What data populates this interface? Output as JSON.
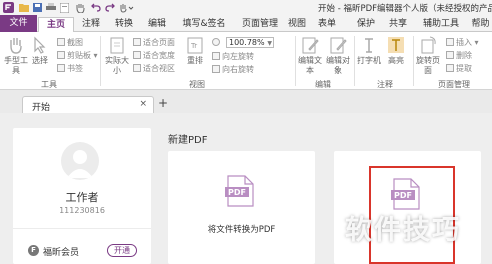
{
  "window": {
    "title": "开始 - 福昕PDF编辑器个人版（未经授权的产品"
  },
  "ribbon_tabs": [
    "文件",
    "主页",
    "注释",
    "转换",
    "编辑",
    "填写&签名",
    "页面管理",
    "视图",
    "表单",
    "保护",
    "共享",
    "辅助工具",
    "帮助"
  ],
  "ribbon": {
    "hand_tool": "手型工具",
    "select": "选择",
    "tools_group": "工具",
    "screenshot": "截图",
    "clipboard": "剪贴板",
    "bookmark": "书签",
    "actual_size": "实际大小",
    "fit_page": "适合页面",
    "fit_width": "适合宽度",
    "fit_visible": "适合视区",
    "reflow": "重排",
    "zoom_value": "100.78%",
    "rotate_left": "向左旋转",
    "rotate_right": "向右旋转",
    "view_group": "视图",
    "edit_text": "编辑文本",
    "edit_object": "编辑对象",
    "edit_group": "编辑",
    "typewriter": "打字机",
    "highlight": "高亮",
    "comment_group": "注释",
    "rotate_page": "旋转页面",
    "insert": "插入",
    "delete": "删除",
    "extract": "提取",
    "page_mgmt_group": "页面管理"
  },
  "doc_tabs": {
    "active": "开始",
    "close": "×",
    "add": "+"
  },
  "user": {
    "name": "工作者",
    "id": "111230816",
    "member_label": "福昕会员",
    "member_badge": "F",
    "open_button": "开通"
  },
  "new_pdf": {
    "section_title": "新建PDF",
    "card1_caption": "将文件转换为PDF",
    "pdf_label": "PDF"
  },
  "watermark": "软件技巧",
  "colors": {
    "accent": "#7a3a84",
    "frame": "#d9352b",
    "pdf_icon": "#b98ec2"
  }
}
